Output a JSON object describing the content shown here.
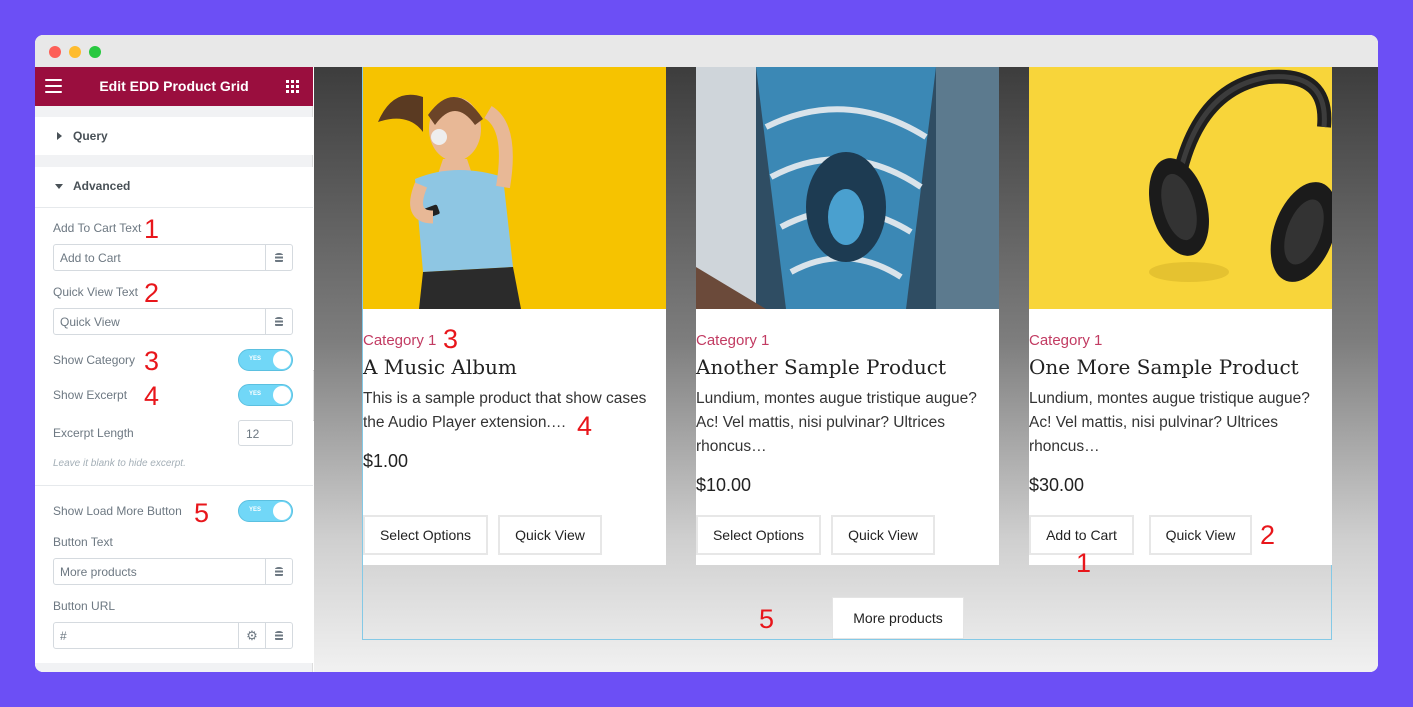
{
  "panel": {
    "title": "Edit EDD Product Grid",
    "sections": {
      "query": "Query",
      "advanced": "Advanced"
    },
    "add_to_cart": {
      "label": "Add To Cart Text",
      "value": "Add to Cart"
    },
    "quick_view": {
      "label": "Quick View Text",
      "value": "Quick View"
    },
    "show_category": {
      "label": "Show Category",
      "toggle": "YES"
    },
    "show_excerpt": {
      "label": "Show Excerpt",
      "toggle": "YES"
    },
    "excerpt_length": {
      "label": "Excerpt Length",
      "value": "12",
      "hint": "Leave it blank to hide excerpt."
    },
    "show_load_more": {
      "label": "Show Load More Button",
      "toggle": "YES"
    },
    "button_text": {
      "label": "Button Text",
      "value": "More products"
    },
    "button_url": {
      "label": "Button URL",
      "value": "#"
    }
  },
  "products": [
    {
      "category": "Category 1",
      "name": "A Music Album",
      "excerpt": "This is a sample product that show cases the Audio Player extension.…",
      "price": "$1.00",
      "buttons": [
        "Select Options",
        "Quick View"
      ],
      "image": "woman-with-headphones"
    },
    {
      "category": "Category 1",
      "name": "Another Sample Product",
      "excerpt": "Lundium, montes augue tristique augue? Ac! Vel mattis, nisi pulvinar? Ultrices rhoncus…",
      "price": "$10.00",
      "buttons": [
        "Select Options",
        "Quick View"
      ],
      "image": "spiral-staircase"
    },
    {
      "category": "Category 1",
      "name": "One More Sample Product",
      "excerpt": "Lundium, montes augue tristique augue? Ac! Vel mattis, nisi pulvinar? Ultrices rhoncus…",
      "price": "$30.00",
      "buttons": [
        "Add to Cart",
        "Quick View"
      ],
      "image": "headphones-on-yellow"
    }
  ],
  "load_more": {
    "label": "More products"
  },
  "markers": [
    "1",
    "2",
    "3",
    "4",
    "5",
    "3",
    "4",
    "2",
    "1",
    "5"
  ],
  "colors": {
    "background": "#6c4ff5",
    "panel_header": "#9a0e3e",
    "toggle": "#71d7f7",
    "category": "#c23b62",
    "marker": "#e8161b"
  }
}
